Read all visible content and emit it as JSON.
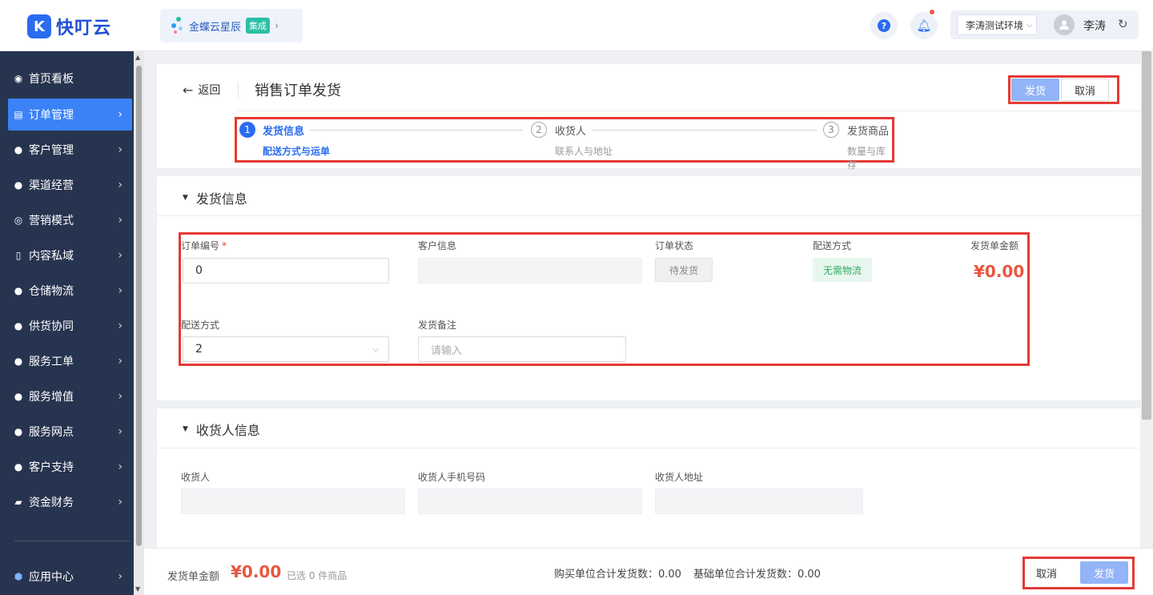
{
  "topbar": {
    "brand": "快叮云",
    "brand_mark": "K",
    "integration_name": "金蝶云星辰",
    "integration_badge": "集成",
    "help_glyph": "?",
    "env_selector": "李涛测试环境",
    "username": "李涛"
  },
  "sidebar": {
    "items": [
      {
        "label": "首页看板",
        "icon": "dashboard-icon"
      },
      {
        "label": "订单管理",
        "icon": "order-icon"
      },
      {
        "label": "客户管理",
        "icon": "user-icon"
      },
      {
        "label": "渠道经营",
        "icon": "user-icon"
      },
      {
        "label": "营销模式",
        "icon": "target-icon"
      },
      {
        "label": "内容私域",
        "icon": "document-icon"
      },
      {
        "label": "仓储物流",
        "icon": "user-icon"
      },
      {
        "label": "供货协同",
        "icon": "users-icon"
      },
      {
        "label": "服务工单",
        "icon": "user-icon"
      },
      {
        "label": "服务增值",
        "icon": "user-icon"
      },
      {
        "label": "服务网点",
        "icon": "user-icon"
      },
      {
        "label": "客户支持",
        "icon": "user-icon"
      },
      {
        "label": "资金财务",
        "icon": "wallet-icon"
      }
    ],
    "active_index": 1,
    "app_center": "应用中心"
  },
  "header": {
    "back": "返回",
    "title": "销售订单发货",
    "ship_button": "发货",
    "cancel_button": "取消"
  },
  "steps": [
    {
      "num": "1",
      "title": "发货信息",
      "desc": "配送方式与运单",
      "active": true
    },
    {
      "num": "2",
      "title": "收货人",
      "desc": "联系人与地址",
      "active": false
    },
    {
      "num": "3",
      "title": "发货商品",
      "desc": "数量与库存",
      "active": false
    }
  ],
  "shipping_section": {
    "title": "发货信息",
    "order_no_label": "订单编号",
    "order_no_required": "*",
    "order_no_value": "0",
    "customer_label": "客户信息",
    "customer_value": "",
    "status_label": "订单状态",
    "status_value": "待发货",
    "delivery_method_label": "配送方式",
    "delivery_method_value": "无需物流",
    "amount_label": "发货单金额",
    "amount_value": "¥0.00",
    "delivery_select_label": "配送方式",
    "delivery_select_value": "2",
    "remark_label": "发货备注",
    "remark_placeholder": "请输入"
  },
  "receiver_section": {
    "title": "收货人信息",
    "name_label": "收货人",
    "phone_label": "收货人手机号码",
    "address_label": "收货人地址"
  },
  "footer": {
    "amount_label": "发货单金额",
    "amount_value": "¥0.00",
    "selected_text": "已选 0 件商品",
    "purchase_total": "购买单位合计发货数：0.00",
    "base_total": "基础单位合计发货数：0.00",
    "cancel_button": "取消",
    "ship_button": "发货"
  },
  "colors": {
    "primary": "#2a6cf0",
    "sidebar_bg": "#273450",
    "highlight_box": "#e53935",
    "amount": "#e8573f",
    "success": "#2bae66"
  }
}
